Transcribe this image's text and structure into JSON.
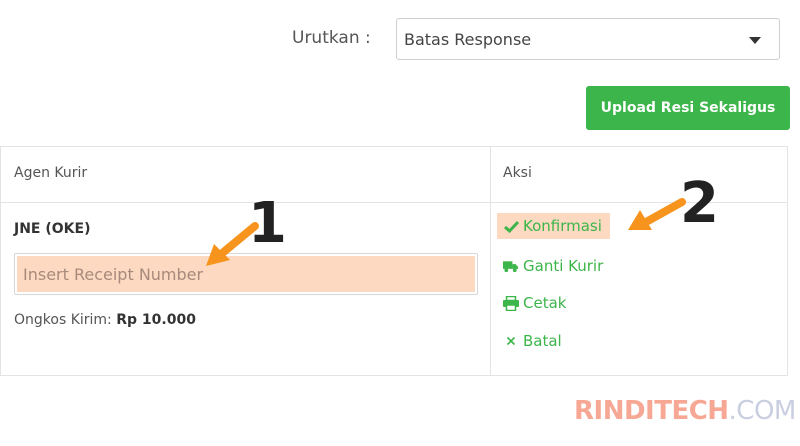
{
  "sort": {
    "label": "Urutkan :",
    "selected": "Batas Response"
  },
  "upload_button": "Upload Resi Sekaligus",
  "table": {
    "headers": {
      "agent": "Agen Kurir",
      "action": "Aksi"
    },
    "row": {
      "courier": "JNE (OKE)",
      "receipt_placeholder": "Insert Receipt Number",
      "shipping_label": "Ongkos Kirim:",
      "shipping_value": "Rp 10.000",
      "actions": {
        "confirm": "Konfirmasi",
        "change_courier": "Ganti Kurir",
        "print": "Cetak",
        "cancel": "Batal"
      }
    }
  },
  "annotations": {
    "marker1": "1",
    "marker2": "2"
  },
  "watermark": {
    "part1": "RINDITECH",
    "part2": ".COM"
  },
  "colors": {
    "green": "#3cb54a",
    "highlight": "#fcd9c0",
    "arrow": "#f7941d"
  },
  "icons": [
    "caret-down-icon",
    "check-icon",
    "truck-icon",
    "printer-icon",
    "times-icon"
  ]
}
